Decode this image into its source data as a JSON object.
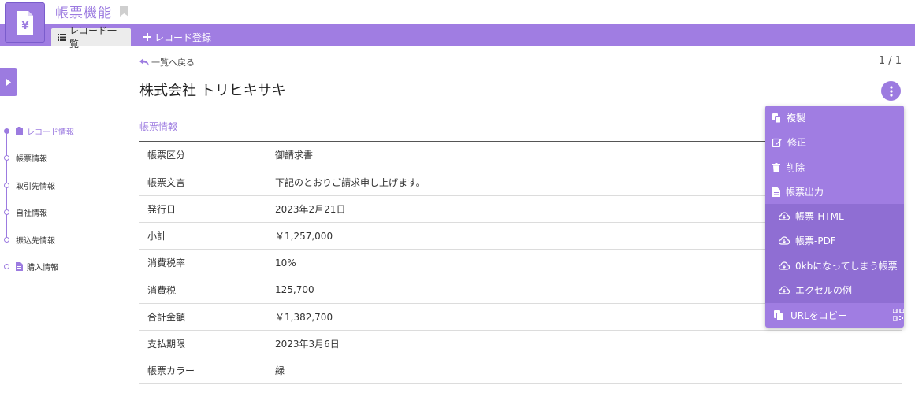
{
  "header": {
    "app_title": "帳票機能"
  },
  "tabs": [
    {
      "label": "レコード一覧"
    },
    {
      "label": "レコード登録"
    }
  ],
  "sidebar": {
    "items": [
      {
        "label": "レコード情報"
      },
      {
        "label": "帳票情報"
      },
      {
        "label": "取引先情報"
      },
      {
        "label": "自社情報"
      },
      {
        "label": "振込先情報"
      },
      {
        "label": "購入情報"
      }
    ]
  },
  "main": {
    "back_label": "一覧へ戻る",
    "pager": "1 / 1",
    "record_title": "株式会社 トリヒキサキ",
    "section_title": "帳票情報",
    "rows": [
      {
        "key": "帳票区分",
        "value": "御請求書"
      },
      {
        "key": "帳票文言",
        "value": "下記のとおりご請求申し上げます。"
      },
      {
        "key": "発行日",
        "value": "2023年2月21日"
      },
      {
        "key": "小計",
        "value": "￥1,257,000"
      },
      {
        "key": "消費税率",
        "value": "10%"
      },
      {
        "key": "消費税",
        "value": "125,700"
      },
      {
        "key": "合計金額",
        "value": "￥1,382,700"
      },
      {
        "key": "支払期限",
        "value": "2023年3月6日"
      },
      {
        "key": "帳票カラー",
        "value": "緑"
      }
    ]
  },
  "menu": {
    "items": [
      {
        "label": "複製",
        "icon": "copy-icon"
      },
      {
        "label": "修正",
        "icon": "edit-icon"
      },
      {
        "label": "削除",
        "icon": "trash-icon"
      },
      {
        "label": "帳票出力",
        "icon": "file-icon"
      }
    ],
    "sub_items": [
      {
        "label": "帳票-HTML",
        "icon": "cloud-download-icon"
      },
      {
        "label": "帳票-PDF",
        "icon": "cloud-download-icon"
      },
      {
        "label": "0kbになってしまう帳票",
        "icon": "cloud-download-icon"
      },
      {
        "label": "エクセルの例",
        "icon": "cloud-download-icon"
      }
    ],
    "copy_url": "URLをコピー"
  },
  "colors": {
    "accent": "#9c7be0",
    "tabbar": "#a07de2",
    "submenu": "#8f6ed3"
  }
}
